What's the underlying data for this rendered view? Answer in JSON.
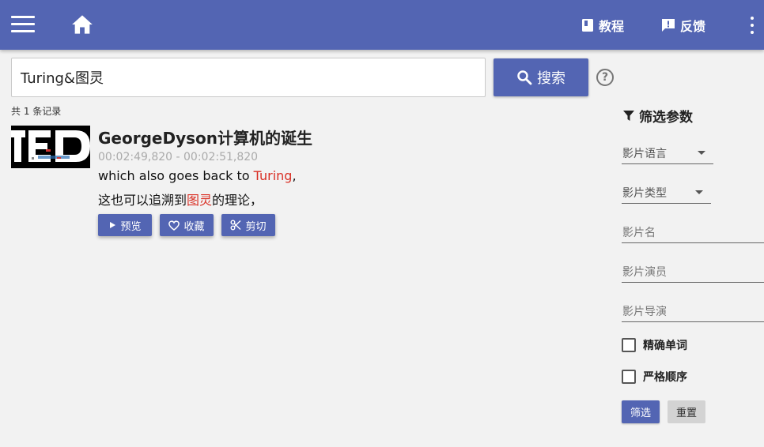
{
  "header": {
    "tutorial_label": "教程",
    "feedback_label": "反馈"
  },
  "search": {
    "value": "Turing&图灵",
    "button_label": "搜索",
    "help": "?"
  },
  "results": {
    "count_text": "共 1 条记录",
    "items": [
      {
        "title": "GeorgeDyson计算机的诞生",
        "time_range": "00:02:49,820 - 00:02:51,820",
        "en_before": "which also goes back to ",
        "en_highlight": "Turing",
        "en_after": ",",
        "zh_before": "这也可以追溯到",
        "zh_highlight": "图灵",
        "zh_after": "的理论，",
        "thumbnail_text": "TED",
        "actions": {
          "preview": "预览",
          "favorite": "收藏",
          "cut": "剪切"
        }
      }
    ]
  },
  "filter": {
    "heading": "筛选参数",
    "language_label": "影片语言",
    "type_label": "影片类型",
    "name_label": "影片名",
    "actor_label": "影片演员",
    "director_label": "影片导演",
    "exact_word_label": "精确单词",
    "strict_order_label": "严格顺序",
    "filter_button": "筛选",
    "reset_button": "重置"
  },
  "colors": {
    "primary": "#5365b3",
    "highlight": "#d93025",
    "background": "#f2f2f2"
  }
}
